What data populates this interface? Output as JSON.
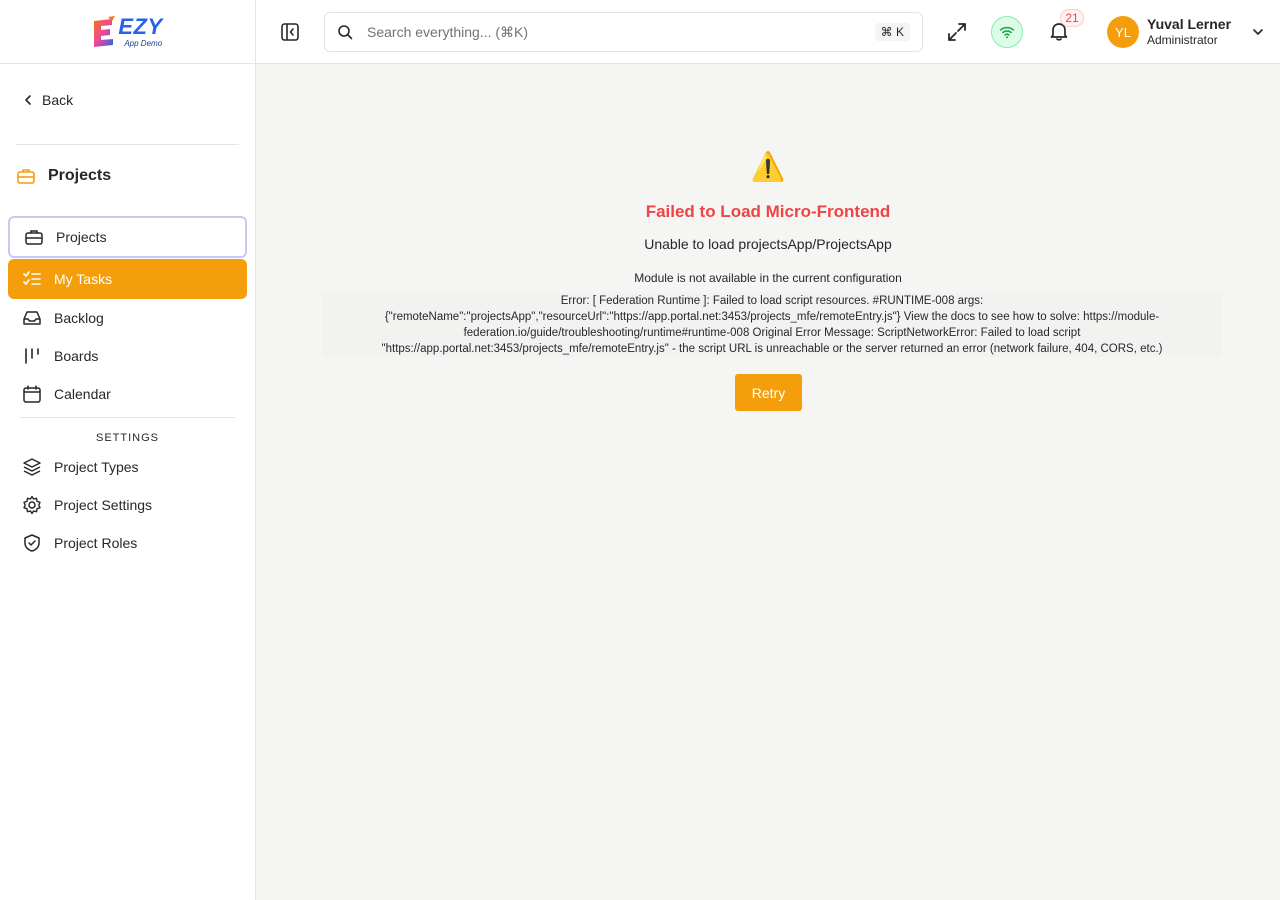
{
  "brand": {
    "name": "EZY",
    "subtitle": "App Demo",
    "accent": "#f59e0b"
  },
  "sidebar": {
    "back_label": "Back",
    "section_title": "Projects",
    "items": [
      {
        "label": "Projects",
        "icon": "briefcase-icon",
        "state": "focused"
      },
      {
        "label": "My Tasks",
        "icon": "list-checks-icon",
        "state": "active"
      },
      {
        "label": "Backlog",
        "icon": "inbox-icon",
        "state": "normal"
      },
      {
        "label": "Boards",
        "icon": "columns-icon",
        "state": "normal"
      },
      {
        "label": "Calendar",
        "icon": "calendar-icon",
        "state": "normal"
      }
    ],
    "settings_label": "SETTINGS",
    "settings_items": [
      {
        "label": "Project Types",
        "icon": "layers-icon"
      },
      {
        "label": "Project Settings",
        "icon": "gear-icon"
      },
      {
        "label": "Project Roles",
        "icon": "shield-check-icon"
      }
    ]
  },
  "header": {
    "search_placeholder": "Search everything... (⌘K)",
    "search_shortcut": "⌘ K",
    "notification_count": "21",
    "user": {
      "initials": "YL",
      "name": "Yuval Lerner",
      "role": "Administrator"
    }
  },
  "error": {
    "icon": "⚠️",
    "title": "Failed to Load Micro-Frontend",
    "subtitle": "Unable to load projectsApp/ProjectsApp",
    "message": "Module is not available in the current configuration",
    "detail": "Error: [ Federation Runtime ]: Failed to load script resources. #RUNTIME-008 args: {\"remoteName\":\"projectsApp\",\"resourceUrl\":\"https://app.portal.net:3453/projects_mfe/remoteEntry.js\"} View the docs to see how to solve: https://module-federation.io/guide/troubleshooting/runtime#runtime-008 Original Error Message: ScriptNetworkError: Failed to load script \"https://app.portal.net:3453/projects_mfe/remoteEntry.js\" - the script URL is unreachable or the server returned an error (network failure, 404, CORS, etc.)",
    "retry_label": "Retry"
  }
}
